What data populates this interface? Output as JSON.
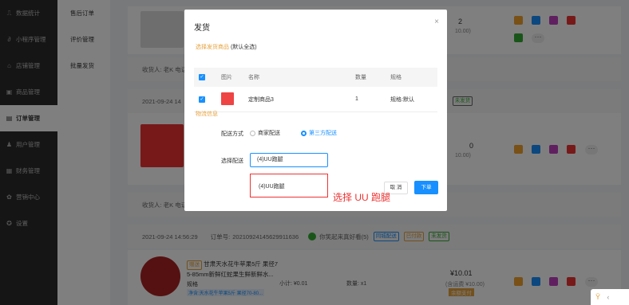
{
  "sidebar": {
    "items": [
      {
        "label": "数据统计",
        "icon": "chart-icon",
        "glyph": "⎍"
      },
      {
        "label": "小程序管理",
        "icon": "link-icon",
        "glyph": "∂"
      },
      {
        "label": "店铺管理",
        "icon": "store-icon",
        "glyph": "⌂"
      },
      {
        "label": "商品管理",
        "icon": "box-icon",
        "glyph": "▣"
      },
      {
        "label": "订单管理",
        "icon": "order-icon",
        "glyph": "▤"
      },
      {
        "label": "用户管理",
        "icon": "user-icon",
        "glyph": "♟"
      },
      {
        "label": "财务管理",
        "icon": "finance-icon",
        "glyph": "▦"
      },
      {
        "label": "营销中心",
        "icon": "marketing-icon",
        "glyph": "✿"
      },
      {
        "label": "设置",
        "icon": "settings-icon",
        "glyph": "✪"
      }
    ]
  },
  "subnav": {
    "items": [
      "售后订单",
      "评价管理",
      "批量发货"
    ]
  },
  "background": {
    "receiver1": "收货人: 老K 电话",
    "date1": "2021-09-24 14",
    "receiver2": "收货人: 老K 电话",
    "order_row": {
      "time": "2021-09-24 14:56:29",
      "order_no_label": "订单号:",
      "order_no": "20210924145629911636",
      "store": "你笑起来真好看(5)",
      "tag_a": "同城配送",
      "tag_b": "已付款",
      "tag_c": "未发货"
    },
    "tag_row2": {
      "tag_a": "未发货"
    },
    "price_top_frag": "2",
    "price_top_sub": "10.00)",
    "price_mid_frag": "0",
    "price_mid_sub": "10.00)",
    "product": {
      "badge": "赠送",
      "title": "甘肃天水花牛苹果5斤 果径7",
      "title2": "5-85mm新鲜红蛇果生鲜新鲜水...",
      "spec_label": "规格",
      "spec_value": "净含:天水花牛苹果5斤 果径70-80...",
      "subtotal": "小计: ¥0.01",
      "qty": "数量: x1",
      "price": "¥10.01",
      "price_sub": "(含运费 ¥10.00)",
      "pay_tag": "余额支付"
    }
  },
  "modal": {
    "title": "发货",
    "close": "×",
    "select_goods_label": "选择发货商品",
    "select_goods_hint": "(默认全选)",
    "table_headers": [
      "图片",
      "名称",
      "数量",
      "规格"
    ],
    "rows": [
      {
        "name": "定制商品3",
        "qty": "1",
        "spec": "规格:默认"
      }
    ],
    "logistics_label": "物流信息",
    "delivery_method_label": "配送方式",
    "delivery_options": [
      "商家配送",
      "第三方配送"
    ],
    "delivery_selected": "第三方配送",
    "choose_delivery_label": "选择配送",
    "choose_delivery_value": "(4)UU跑腿",
    "dropdown_option": "(4)UU跑腿",
    "cancel_label": "取 消",
    "ok_label": "下单"
  },
  "annotation": "选择 UU 跑腿",
  "colors": {
    "accent": "#1890ff",
    "warn": "#e6a23c",
    "annotation": "#e33333",
    "sidebar_bg": "#2b2b2b"
  }
}
